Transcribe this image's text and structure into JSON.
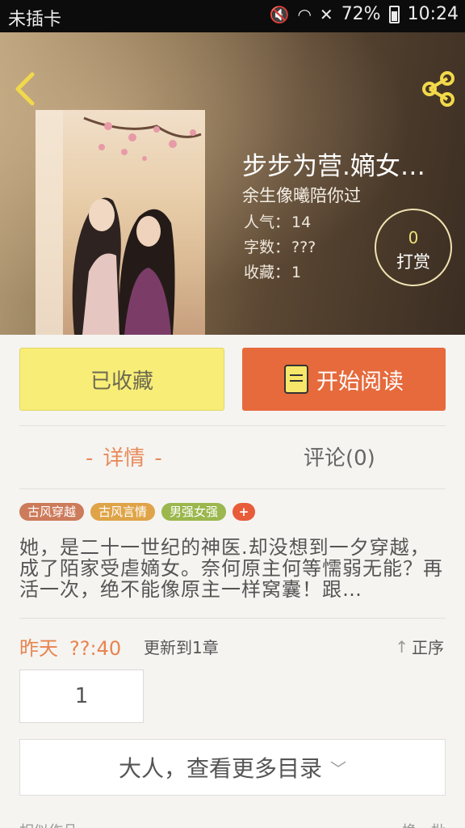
{
  "status_bar": {
    "carrier": "未插卡",
    "battery": "72%",
    "time": "10:24"
  },
  "header": {
    "back_icon": "chevron-left-icon",
    "share_icon": "share-icon"
  },
  "book": {
    "title": "步步为营.嫡女…",
    "author": "余生像曦陪你过",
    "popularity_label": "人气：",
    "popularity": "14",
    "words_label": "字数：",
    "words": "???",
    "favorites_label": "收藏：",
    "favorites": "1"
  },
  "reward": {
    "count": "0",
    "label": "打赏"
  },
  "actions": {
    "favorited_label": "已收藏",
    "read_label": "开始阅读"
  },
  "tabs": {
    "details": "详情",
    "comments": "评论(0)"
  },
  "tags": [
    "古风穿越",
    "古风言情",
    "男强女强",
    "+"
  ],
  "synopsis": "她，是二十一世纪的神医.却没想到一夕穿越，成了陌家受虐嫡女。奈何原主何等懦弱无能？再活一次，绝不能像原主一样窝囊！跟…",
  "update": {
    "day": "昨天",
    "time": "??:40",
    "label": "更新到1章",
    "order_label": "正序"
  },
  "chapters": [
    "1"
  ],
  "more_catalog": "大人，查看更多目录",
  "footer": {
    "left": "相似作品",
    "right": "换一批"
  },
  "colors": {
    "accent_orange": "#e66a3c",
    "favorite_yellow": "#f8ed77",
    "tag1": "#cc7b5b",
    "tag2": "#dfa448",
    "tag3": "#9bb74d",
    "tag_plus": "#e85c3a"
  }
}
